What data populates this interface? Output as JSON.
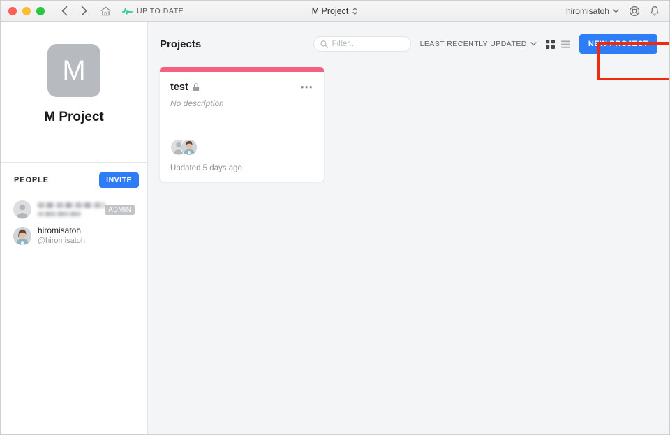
{
  "window": {
    "traffic_lights": [
      "close",
      "minimize",
      "zoom"
    ],
    "nav_back": "back-icon",
    "nav_forward": "forward-icon",
    "home": "home-icon",
    "sync_status": "UP TO DATE",
    "sync_icon": "pulse-icon",
    "title": "M Project",
    "title_switcher_icon": "up-down-chevron-icon",
    "account_name": "hiromisatoh",
    "account_caret_icon": "chevron-down-icon",
    "help_icon": "lifebuoy-icon",
    "notifications_icon": "bell-icon"
  },
  "sidebar": {
    "team": {
      "avatar_initial": "M",
      "name": "M Project"
    },
    "people": {
      "heading": "PEOPLE",
      "invite_label": "INVITE",
      "members": [
        {
          "name": "",
          "handle": "",
          "badge": "ADMIN",
          "redacted": true,
          "avatar": "placeholder-avatar"
        },
        {
          "name": "hiromisatoh",
          "handle": "@hiromisatoh",
          "badge": "",
          "redacted": false,
          "avatar": "photo-avatar"
        }
      ]
    }
  },
  "main": {
    "page_title": "Projects",
    "filter": {
      "value": "",
      "placeholder": "Filter...",
      "icon": "search-icon"
    },
    "sort": {
      "label": "LEAST RECENTLY UPDATED",
      "caret_icon": "chevron-down-icon"
    },
    "views": {
      "grid_icon": "grid-view-icon",
      "list_icon": "list-view-icon",
      "active": "grid"
    },
    "new_project_label": "NEW PROJECT",
    "projects": [
      {
        "accent_color": "#f4607f",
        "title": "test",
        "visibility_icon": "lock-icon",
        "menu_icon": "ellipsis-icon",
        "description": "No description",
        "members": 2,
        "updated": "Updated 5 days ago"
      }
    ]
  },
  "annotation": {
    "type": "highlight-rectangle",
    "color": "#ef2b0d",
    "target": "new-project-button"
  }
}
